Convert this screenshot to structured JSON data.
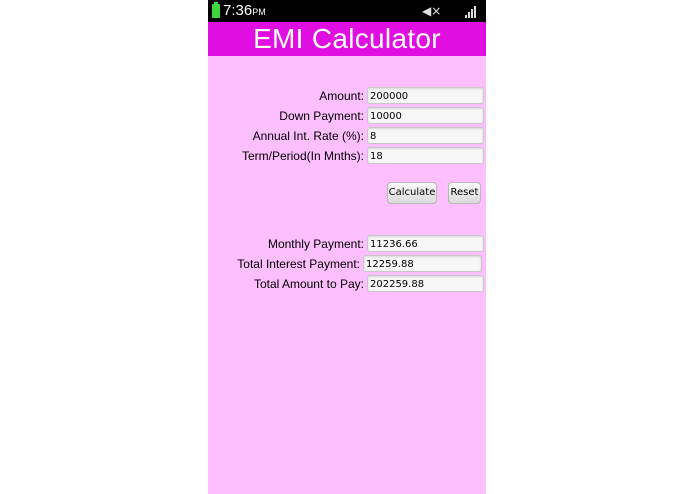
{
  "statusbar": {
    "time": "7:36",
    "ampm": "PM"
  },
  "app": {
    "title": "EMI Calculator"
  },
  "inputs": [
    {
      "label": "Amount:",
      "value": "200000"
    },
    {
      "label": "Down Payment:",
      "value": "10000"
    },
    {
      "label": "Annual Int. Rate (%):",
      "value": "8"
    },
    {
      "label": "Term/Period(In Mnths):",
      "value": "18"
    }
  ],
  "buttons": {
    "calculate": "Calculate",
    "reset": "Reset"
  },
  "results": [
    {
      "label": "Monthly Payment:",
      "value": "11236.66"
    },
    {
      "label": "Total Interest Payment:",
      "value": "12259.88"
    },
    {
      "label": "Total Amount to Pay:",
      "value": "202259.88"
    }
  ],
  "colors": {
    "titlebar": "#e10ee1",
    "background": "#fdbffd"
  }
}
